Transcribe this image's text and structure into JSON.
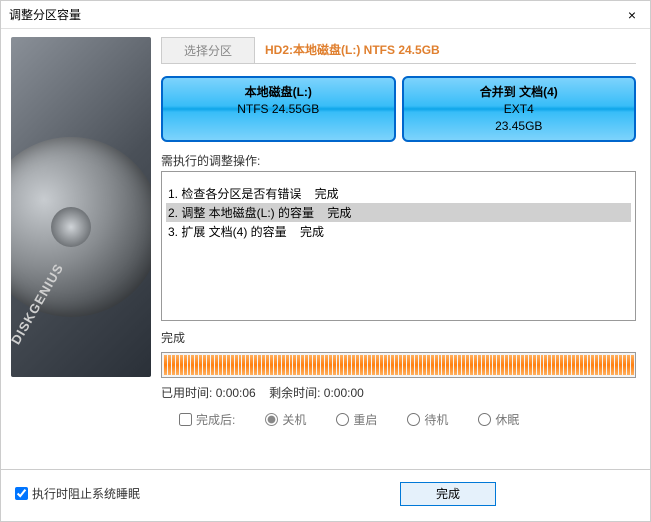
{
  "window": {
    "title": "调整分区容量",
    "close": "×"
  },
  "sidebar": {
    "brand": "DISKGENIUS"
  },
  "tabs": {
    "select_label": "选择分区",
    "active_label": "HD2:本地磁盘(L:) NTFS 24.5GB"
  },
  "partitions": [
    {
      "title": "本地磁盘(L:)",
      "subtitle": "NTFS 24.55GB"
    },
    {
      "title": "合并到 文档(4)",
      "subtitle": "EXT4",
      "subtitle2": "23.45GB"
    }
  ],
  "ops": {
    "header": "需执行的调整操作:",
    "items": [
      "1. 检查各分区是否有错误    完成",
      "2. 调整 本地磁盘(L:) 的容量    完成",
      "3. 扩展 文档(4) 的容量    完成"
    ],
    "selected_index": 1
  },
  "status": "完成",
  "timing": {
    "elapsed_label": "已用时间:",
    "elapsed_value": "0:00:06",
    "remain_label": "剩余时间:",
    "remain_value": "0:00:00"
  },
  "after": {
    "checkbox_label": "完成后:",
    "options": [
      "关机",
      "重启",
      "待机",
      "休眠"
    ],
    "checked": false,
    "selected": 0
  },
  "footer": {
    "prevent_sleep_label": "执行时阻止系统睡眠",
    "prevent_sleep_checked": true,
    "done_button": "完成"
  }
}
